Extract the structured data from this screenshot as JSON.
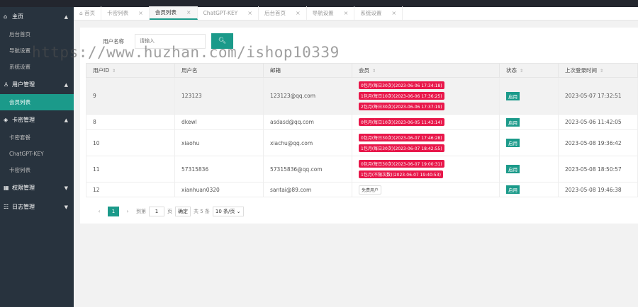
{
  "sidebar": {
    "groups": [
      {
        "label": "主页",
        "subs": [
          "后台首页",
          "导航设置",
          "系统设置"
        ]
      },
      {
        "label": "用户管理",
        "subs": [
          "会员列表"
        ]
      },
      {
        "label": "卡密管理",
        "subs": [
          "卡密套餐",
          "ChatGPT-KEY",
          "卡密列表"
        ]
      },
      {
        "label": "权限管理"
      },
      {
        "label": "日志管理"
      }
    ]
  },
  "tabs": [
    {
      "label": "首页"
    },
    {
      "label": "卡密列表"
    },
    {
      "label": "会员列表"
    },
    {
      "label": "ChatGPT-KEY"
    },
    {
      "label": "后台首页"
    },
    {
      "label": "导航设置"
    },
    {
      "label": "系统设置"
    }
  ],
  "search": {
    "label": "用户名称",
    "placeholder": "请输入"
  },
  "table": {
    "headers": [
      "用户ID",
      "用户名",
      "邮箱",
      "会员",
      "状态",
      "上次登录时间"
    ],
    "rows": [
      {
        "id": "9",
        "username": "123123",
        "email": "123123@qq.com",
        "member": [
          "0包月(每日30次)(2023-06-06 17:34:18)",
          "1包月(每日10次)(2023-06-06 17:36:25)",
          "2包月(每日30次)(2023-06-06 17:37:19)"
        ],
        "status": "启用",
        "last_login": "2023-05-07 17:32:51"
      },
      {
        "id": "8",
        "username": "dkewl",
        "email": "asdasd@qq.com",
        "member": [
          "0包月(每日10次)(2023-06-05 11:43:14)"
        ],
        "status": "启用",
        "last_login": "2023-05-06 11:42:05"
      },
      {
        "id": "10",
        "username": "xiaohu",
        "email": "xiachu@qq.com",
        "member": [
          "0包月(每日30次)(2023-06-07 17:46:28)",
          "1包月(每日30次)(2023-06-07 18:42:55)"
        ],
        "status": "启用",
        "last_login": "2023-05-08 19:36:42"
      },
      {
        "id": "11",
        "username": "57315836",
        "email": "57315836@qq.com",
        "member": [
          "0包月(每日30次)(2023-06-07 19:00:31)",
          "1包月(不限次数)(2023-06-07 19:40:53)"
        ],
        "status": "启用",
        "last_login": "2023-05-08 18:50:57"
      },
      {
        "id": "12",
        "username": "xianhuan0320",
        "email": "santai@89.com",
        "member_plain": "免费用户",
        "status": "启用",
        "last_login": "2023-05-08 19:46:38"
      }
    ]
  },
  "pager": {
    "current": "1",
    "goto_label": "到第",
    "goto_value": "1",
    "page_unit": "页",
    "confirm": "确定",
    "total": "共 5 条",
    "per_page": "10 条/页"
  },
  "watermark": "https://www.huzhan.com/ishop10339",
  "colors": {
    "accent": "#1b9a8a",
    "badge": "#e8174a",
    "sidebar": "#28333e"
  }
}
